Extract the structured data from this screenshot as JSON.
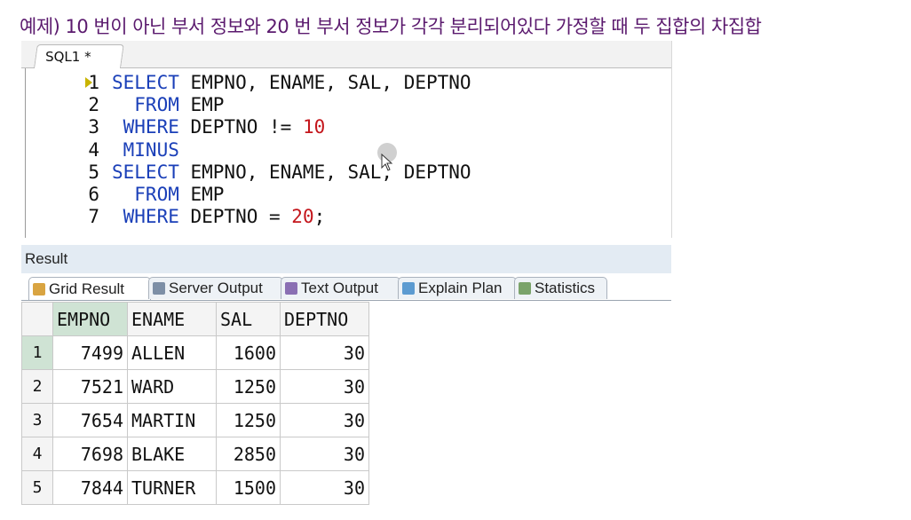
{
  "caption": "예제) 10 번이 아닌 부서 정보와 20 번 부서 정보가 각각 분리되어있다 가정할 때 두 집합의 차집합",
  "editor": {
    "tab_label": "SQL1 *",
    "lines": [
      {
        "num": "1",
        "parts": [
          {
            "t": "SELECT",
            "k": "kw"
          },
          {
            "t": " EMPNO, ENAME, SAL, DEPTNO",
            "k": ""
          }
        ]
      },
      {
        "num": "2",
        "parts": [
          {
            "t": "  FROM",
            "k": "kw"
          },
          {
            "t": " EMP",
            "k": ""
          }
        ]
      },
      {
        "num": "3",
        "parts": [
          {
            "t": " WHERE",
            "k": "kw"
          },
          {
            "t": " DEPTNO != ",
            "k": ""
          },
          {
            "t": "10",
            "k": "num"
          }
        ]
      },
      {
        "num": "4",
        "parts": [
          {
            "t": " MINUS",
            "k": "kw"
          }
        ]
      },
      {
        "num": "5",
        "parts": [
          {
            "t": "SELECT",
            "k": "kw"
          },
          {
            "t": " EMPNO, ENAME, SAL, DEPTNO",
            "k": ""
          }
        ]
      },
      {
        "num": "6",
        "parts": [
          {
            "t": "  FROM",
            "k": "kw"
          },
          {
            "t": " EMP",
            "k": ""
          }
        ]
      },
      {
        "num": "7",
        "parts": [
          {
            "t": " WHERE",
            "k": "kw"
          },
          {
            "t": " DEPTNO = ",
            "k": ""
          },
          {
            "t": "20",
            "k": "num"
          },
          {
            "t": ";",
            "k": ""
          }
        ]
      }
    ]
  },
  "result": {
    "title": "Result",
    "tabs": [
      {
        "label": "Grid Result",
        "icon": "grid-icon",
        "color": "#d9a441"
      },
      {
        "label": "Server Output",
        "icon": "server-output-icon",
        "color": "#7d8fa6"
      },
      {
        "label": "Text Output",
        "icon": "text-output-icon",
        "color": "#8a6fb3"
      },
      {
        "label": "Explain Plan",
        "icon": "explain-plan-icon",
        "color": "#5c9bd1"
      },
      {
        "label": "Statistics",
        "icon": "statistics-icon",
        "color": "#7aa36a"
      }
    ],
    "columns": [
      "EMPNO",
      "ENAME",
      "SAL",
      "DEPTNO"
    ],
    "rows": [
      {
        "n": "1",
        "cells": [
          "7499",
          "ALLEN",
          "1600",
          "30"
        ]
      },
      {
        "n": "2",
        "cells": [
          "7521",
          "WARD",
          "1250",
          "30"
        ]
      },
      {
        "n": "3",
        "cells": [
          "7654",
          "MARTIN",
          "1250",
          "30"
        ]
      },
      {
        "n": "4",
        "cells": [
          "7698",
          "BLAKE",
          "2850",
          "30"
        ]
      },
      {
        "n": "5",
        "cells": [
          "7844",
          "TURNER",
          "1500",
          "30"
        ]
      }
    ]
  },
  "colors": {
    "keyword": "#1a3fb8",
    "number": "#c4161c",
    "caption": "#5b1a6e",
    "selected": "#cfe3d4"
  }
}
